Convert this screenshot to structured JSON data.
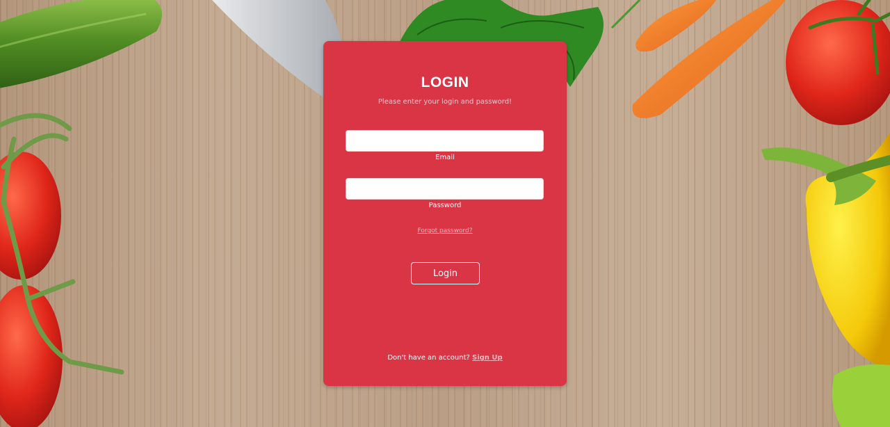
{
  "login_card": {
    "title": "LOGIN",
    "subtitle": "Please enter your login and password!",
    "email": {
      "label": "Email",
      "value": "",
      "placeholder": ""
    },
    "password": {
      "label": "Password",
      "value": "",
      "placeholder": ""
    },
    "forgot_password_label": "Forgot password?",
    "login_button_label": "Login",
    "footer": {
      "prompt": "Don't have an account?",
      "signup_label": "Sign Up"
    }
  },
  "colors": {
    "card": "#d93545",
    "link": "#f4b8bf",
    "background_wood": "#b79d84"
  },
  "background_items": [
    "cucumber",
    "knife",
    "parsley",
    "carrots",
    "tomato",
    "cherry-tomatoes-on-vine",
    "yellow-pepper",
    "green-pepper"
  ]
}
